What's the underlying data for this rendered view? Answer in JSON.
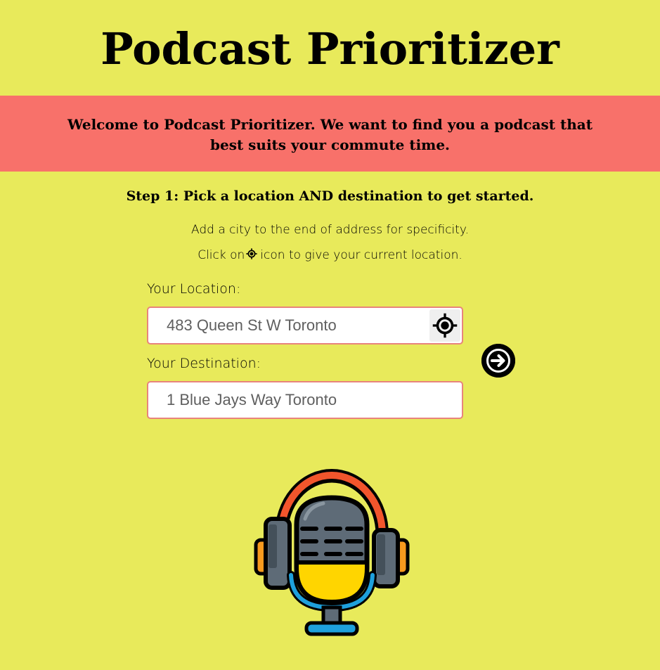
{
  "header": {
    "title": "Podcast Prioritizer"
  },
  "banner": {
    "text": "Welcome to Podcast Prioritizer. We want to find you a podcast that best suits your commute time."
  },
  "instructions": {
    "step": "Step 1: Pick a location AND destination to get started.",
    "hint_city": "Add a city to the end of address for specificity.",
    "hint_click_prefix": "Click on",
    "hint_click_icon": "crosshair-icon",
    "hint_click_suffix": "icon to give your current location."
  },
  "form": {
    "location_label": "Your Location:",
    "location_placeholder": "483 Queen St W Toronto",
    "location_value": "",
    "locate_button_icon": "crosshair-icon",
    "destination_label": "Your Destination:",
    "destination_placeholder": "1 Blue Jays Way Toronto",
    "destination_value": "",
    "submit_icon": "arrow-right-circle-icon"
  },
  "illustration": {
    "icon": "podcast-microphone-headphones-icon"
  },
  "colors": {
    "background": "#e8ea5b",
    "banner": "#f8716a",
    "input_border": "#e8847c",
    "headphone_band": "#f2552c",
    "mic_base": "#ffd500",
    "mic_stand": "#1ea0dc"
  }
}
